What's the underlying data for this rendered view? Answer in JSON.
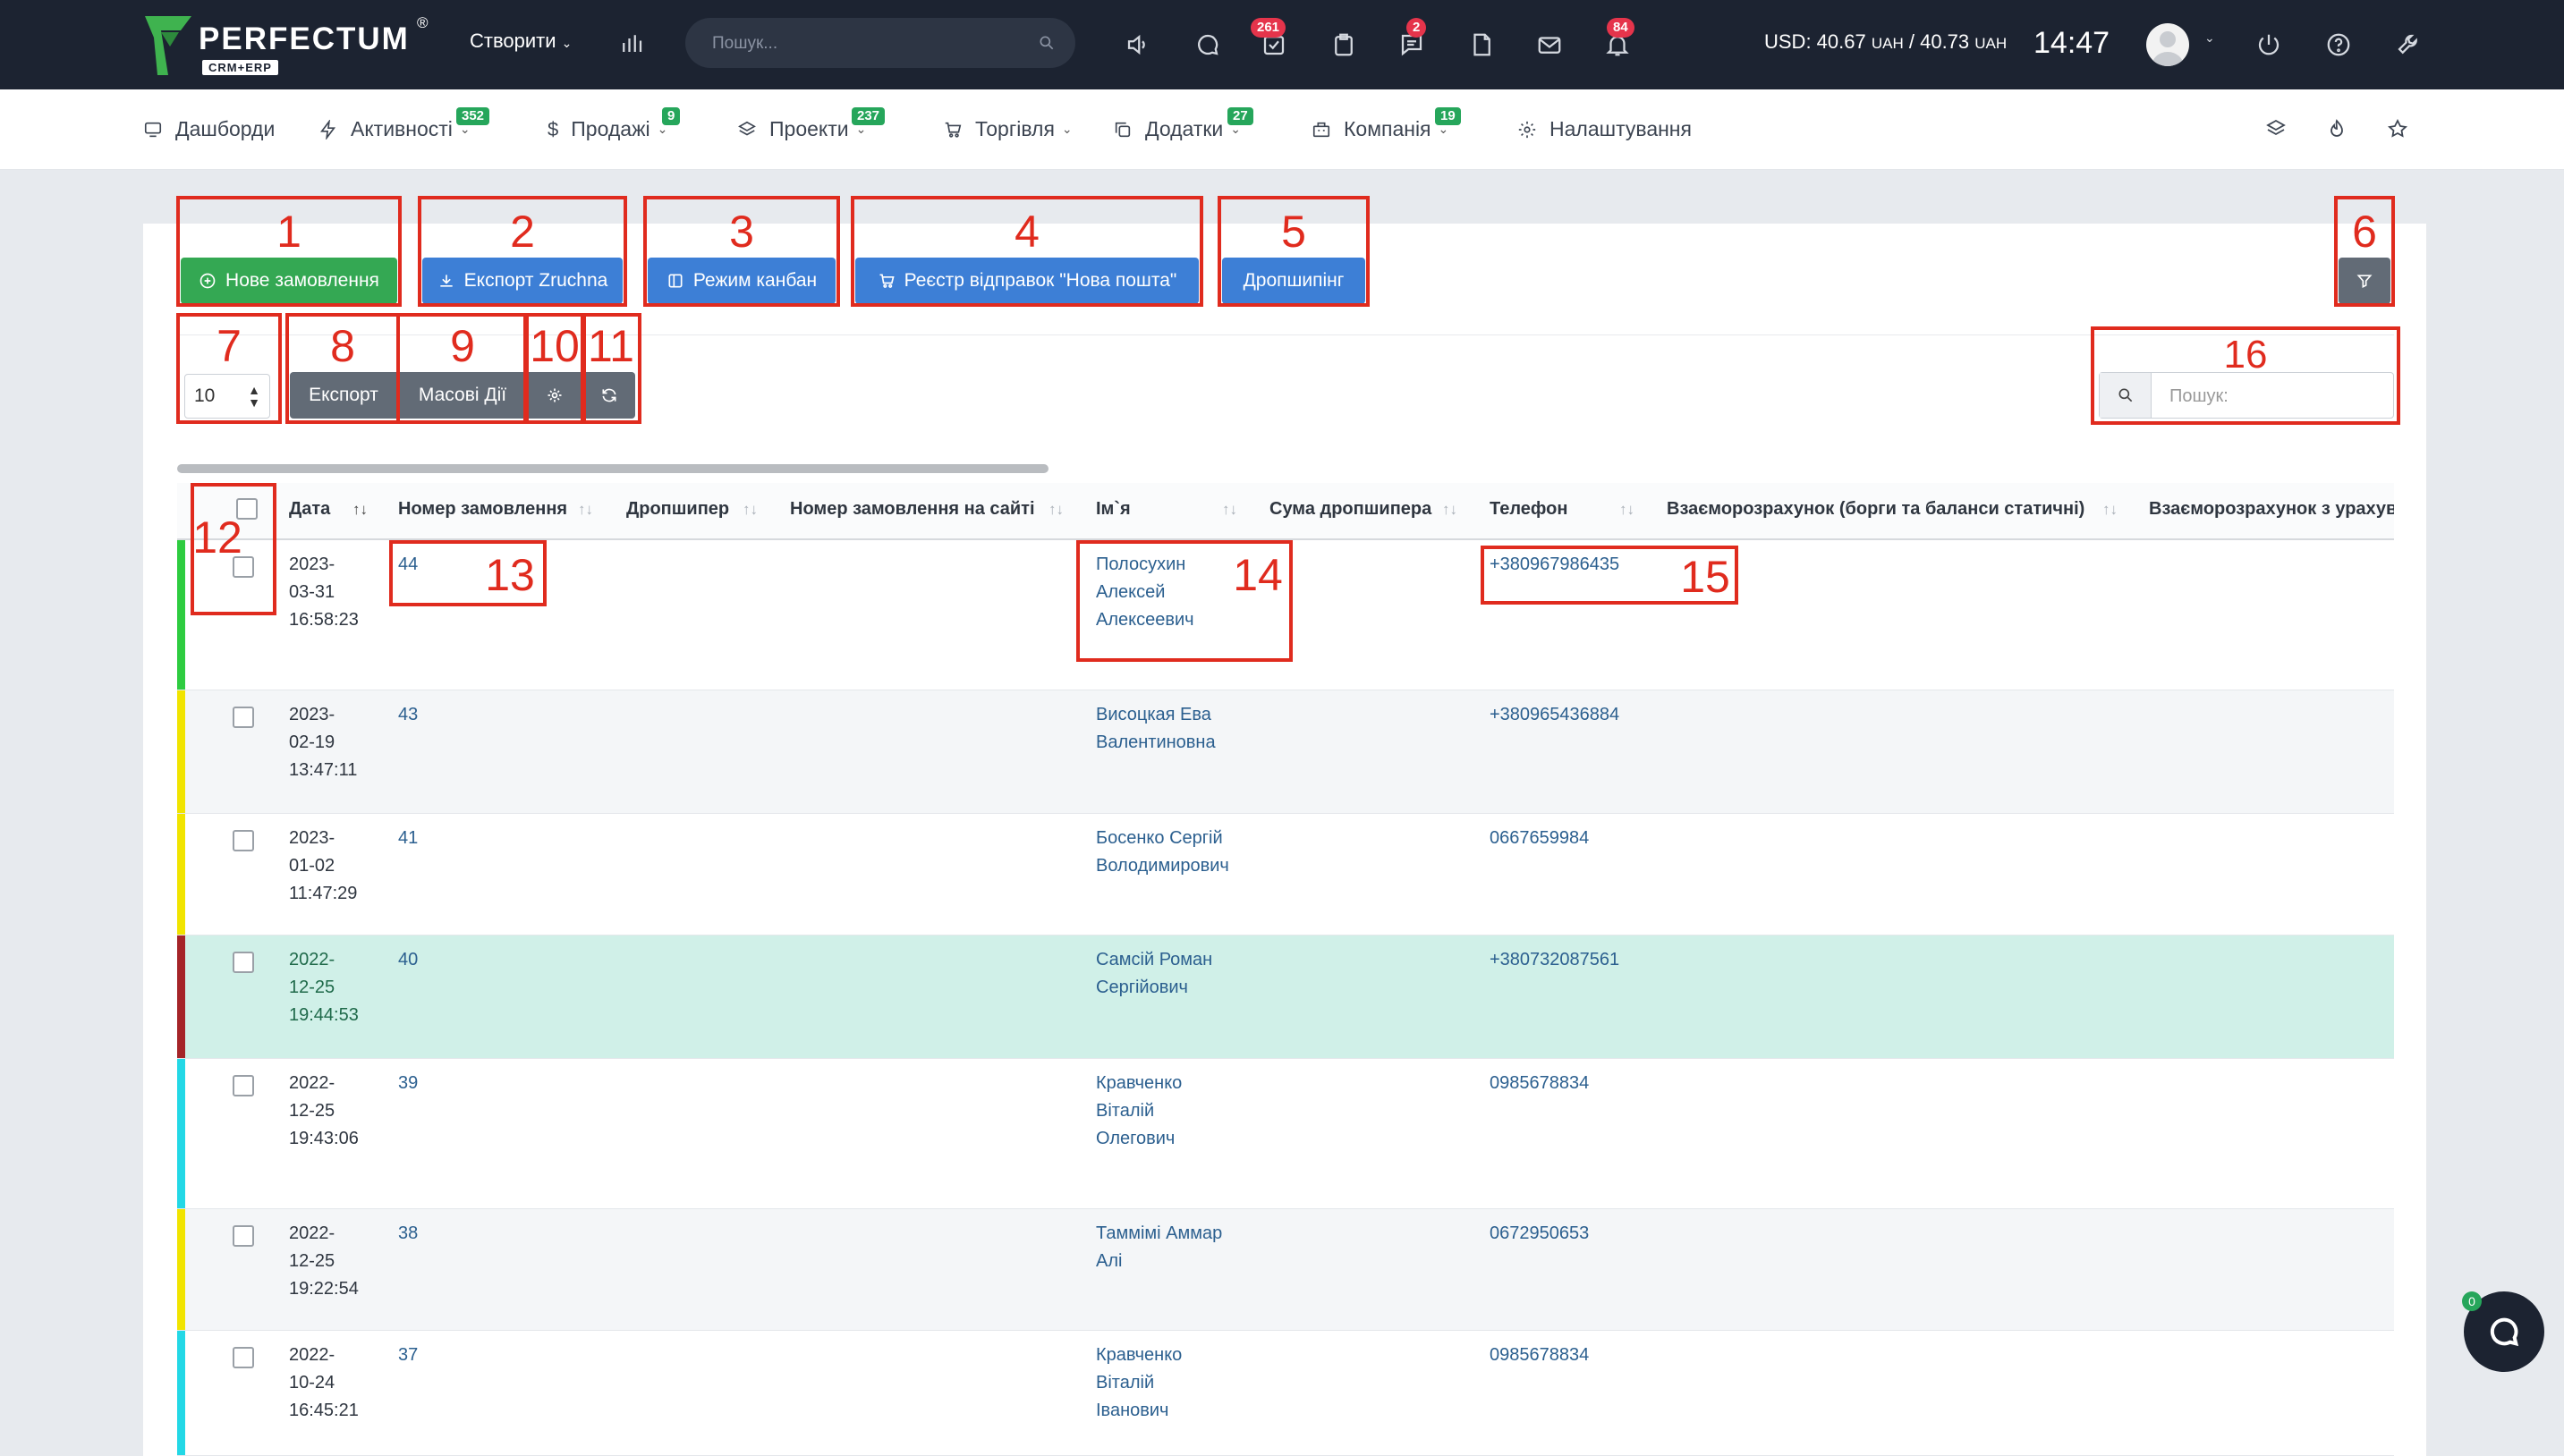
{
  "topbar": {
    "logo": "PERFECTUM",
    "logo_reg": "®",
    "logo_sub": "CRM+ERP",
    "create_label": "Створити",
    "search_placeholder": "Пошук...",
    "badges": {
      "tasks": "261",
      "chat": "2",
      "notifications": "84"
    },
    "rate_main": "USD: 40.67",
    "rate_unit1": "UAH",
    "rate_sep": " / 40.73",
    "rate_unit2": "UAH",
    "time": "14:47"
  },
  "nav": {
    "dashboards": "Дашборди",
    "activities": "Активності",
    "activities_badge": "352",
    "sales": "Продажі",
    "sales_badge": "9",
    "projects": "Проекти",
    "projects_badge": "237",
    "trade": "Торгівля",
    "addons": "Додатки",
    "addons_badge": "27",
    "company": "Компанія",
    "company_badge": "19",
    "settings": "Налаштування"
  },
  "toolbar": {
    "new_order": "Нове замовлення",
    "export_zruchna": "Експорт Zruchna",
    "kanban": "Режим канбан",
    "nova_poshta": "Реєстр відправок \"Нова пошта\"",
    "dropshipping": "Дропшипінг",
    "page_size": "10",
    "export": "Експорт",
    "mass_actions": "Масові Дії",
    "search_placeholder": "Пошук:"
  },
  "annotations": [
    "1",
    "2",
    "3",
    "4",
    "5",
    "6",
    "7",
    "8",
    "9",
    "10",
    "11",
    "12",
    "13",
    "14",
    "15",
    "16"
  ],
  "table": {
    "headers": [
      "Дата",
      "Номер замовлення",
      "Дропшипер",
      "Номер замовлення на сайті",
      "Ім`я",
      "Сума дропшипера",
      "Телефон",
      "Взаєморозрахунок (борги та баланси статичні)",
      "Взаєморозрахунок з урахуванням"
    ],
    "rows": [
      {
        "date": [
          "2023-",
          "03-31",
          "16:58:23"
        ],
        "number": "44",
        "name": [
          "Полосухин",
          "Алексей",
          "Алексеевич"
        ],
        "phone": "+380967986435",
        "color": "#2ecc40"
      },
      {
        "date": [
          "2023-",
          "02-19",
          "13:47:11"
        ],
        "number": "43",
        "name": [
          "Висоцкая Ева",
          "Валентиновна"
        ],
        "phone": "+380965436884",
        "color": "#f1e400"
      },
      {
        "date": [
          "2023-",
          "01-02",
          "11:47:29"
        ],
        "number": "41",
        "name": [
          "Босенко Сергій",
          "Володимирович"
        ],
        "phone": "0667659984",
        "color": "#f1e400"
      },
      {
        "date": [
          "2022-",
          "12-25",
          "19:44:53"
        ],
        "number": "40",
        "name": [
          "Самсій Роман",
          "Сергійович"
        ],
        "phone": "+380732087561",
        "color": "#a52428"
      },
      {
        "date": [
          "2022-",
          "12-25",
          "19:43:06"
        ],
        "number": "39",
        "name": [
          "Кравченко",
          "Віталій",
          "Олегович"
        ],
        "phone": "0985678834",
        "color": "#23d8e6"
      },
      {
        "date": [
          "2022-",
          "12-25",
          "19:22:54"
        ],
        "number": "38",
        "name": [
          "Таммімі Аммар",
          "Алі"
        ],
        "phone": "0672950653",
        "color": "#f1e400"
      },
      {
        "date": [
          "2022-",
          "10-24",
          "16:45:21"
        ],
        "number": "37",
        "name": [
          "Кравченко",
          "Віталій",
          "Іванович"
        ],
        "phone": "0985678834",
        "color": "#23d8e6"
      }
    ]
  },
  "chat_badge": "0"
}
